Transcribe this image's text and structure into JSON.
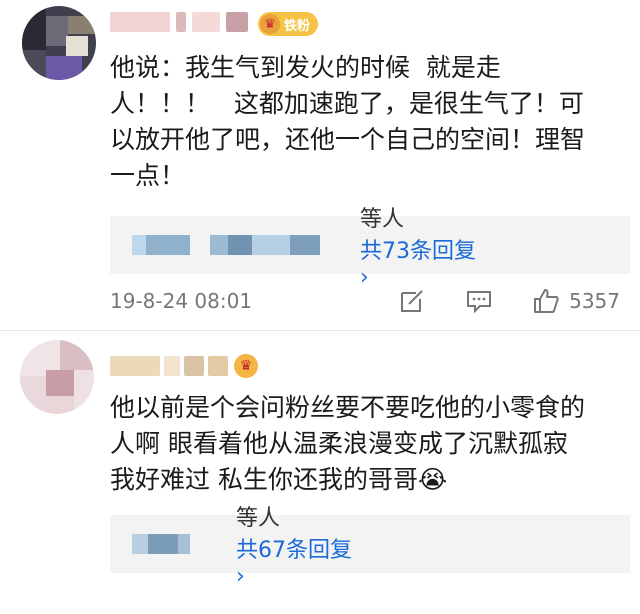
{
  "comments": [
    {
      "badge_label": "铁粉",
      "text_lines": [
        "他说：我生气到发火的时候  就是走",
        "人！！！   这都加速跑了，是很生气了！可",
        "以放开他了吧，还他一个自己的空间！理智",
        "一点！"
      ],
      "reply_suffix": "等人",
      "reply_count": "共73条回复",
      "reply_chevron": "›",
      "date": "19-8-24 08:01",
      "likes": "5357",
      "icons": [
        "repost-icon",
        "comment-icon",
        "like-icon"
      ]
    },
    {
      "text_lines": [
        "他以前是个会问粉丝要不要吃他的小零食的",
        "人啊 眼看着他从温柔浪漫变成了沉默孤寂",
        "我好难过 私生你还我的哥哥😭"
      ],
      "reply_suffix": "等人",
      "reply_count": "共67条回复",
      "reply_chevron": "›"
    }
  ],
  "colors": {
    "link": "#1b6ad7",
    "badge": "#f6c243",
    "crown": "#c6202c"
  }
}
